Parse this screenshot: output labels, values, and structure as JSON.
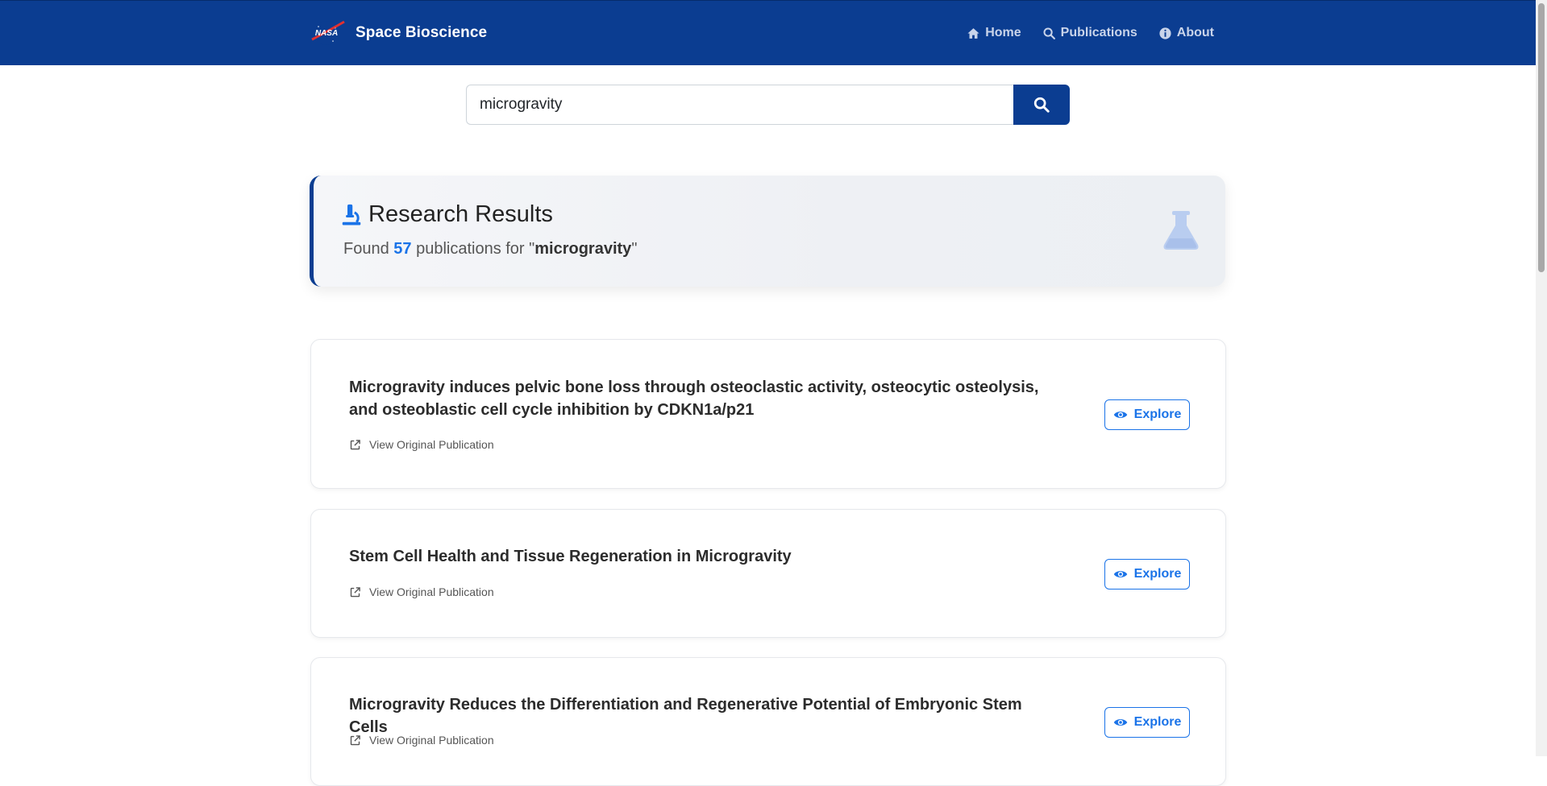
{
  "navbar": {
    "brand": "Space Bioscience",
    "logo_text": "NASA",
    "links": [
      {
        "label": "Home",
        "icon": "home-icon"
      },
      {
        "label": "Publications",
        "icon": "search-icon"
      },
      {
        "label": "About",
        "icon": "info-icon"
      }
    ]
  },
  "search": {
    "value": "microgravity",
    "button_icon": "search-icon"
  },
  "results_header": {
    "title": "Research Results",
    "found_prefix": "Found ",
    "count": "57",
    "found_middle": " publications for \"",
    "query": "microgravity",
    "found_suffix": "\"",
    "title_icon": "microscope-icon",
    "side_icon": "flask-icon"
  },
  "publications": [
    {
      "title": "Microgravity induces pelvic bone loss through osteoclastic activity, osteocytic osteolysis, and osteoblastic cell cycle inhibition by CDKN1a/p21",
      "link_label": "View Original Publication",
      "explore_label": "Explore"
    },
    {
      "title": "Stem Cell Health and Tissue Regeneration in Microgravity",
      "link_label": "View Original Publication",
      "explore_label": "Explore"
    },
    {
      "title": "Microgravity Reduces the Differentiation and Regenerative Potential of Embryonic Stem Cells",
      "link_label": "View Original Publication",
      "explore_label": "Explore"
    }
  ],
  "colors": {
    "navbar": "#0b3d91",
    "accent": "#1a73e8",
    "nav_link": "#c9d4ea"
  }
}
